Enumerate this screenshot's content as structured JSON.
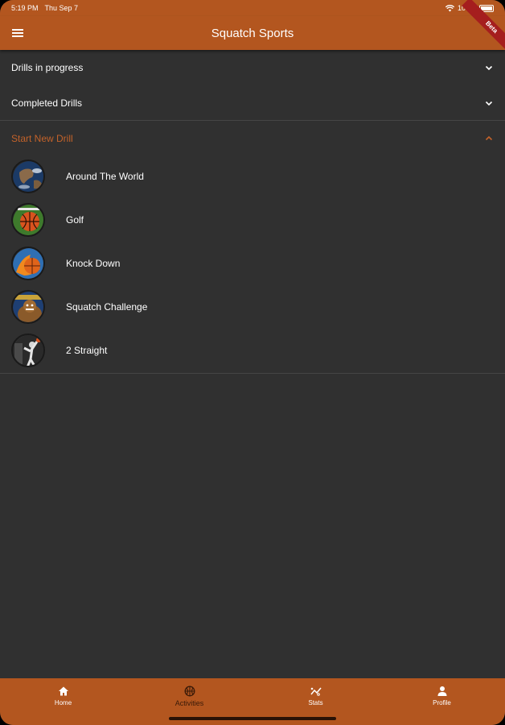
{
  "status_bar": {
    "time": "5:19 PM",
    "date": "Thu Sep 7",
    "battery": "100%"
  },
  "app_bar": {
    "title": "Squatch Sports",
    "ribbon": "Beta"
  },
  "sections": [
    {
      "label": "Drills in progress",
      "expanded": false
    },
    {
      "label": "Completed Drills",
      "expanded": false
    },
    {
      "label": "Start New Drill",
      "expanded": true
    }
  ],
  "drills": [
    {
      "label": "Around The World",
      "icon": "globe-icon"
    },
    {
      "label": "Golf",
      "icon": "basketball-hoop-icon"
    },
    {
      "label": "Knock Down",
      "icon": "flaming-ball-icon"
    },
    {
      "label": "Squatch Challenge",
      "icon": "squatch-mascot-icon"
    },
    {
      "label": "2 Straight",
      "icon": "player-shooting-icon"
    }
  ],
  "bottom_nav": [
    {
      "label": "Home",
      "icon": "home-icon"
    },
    {
      "label": "Activities",
      "icon": "basketball-icon",
      "active": true
    },
    {
      "label": "Stats",
      "icon": "stats-icon"
    },
    {
      "label": "Profile",
      "icon": "person-icon"
    }
  ],
  "colors": {
    "accent": "#B3561F",
    "background": "#303030",
    "active_section": "#C2622A"
  }
}
